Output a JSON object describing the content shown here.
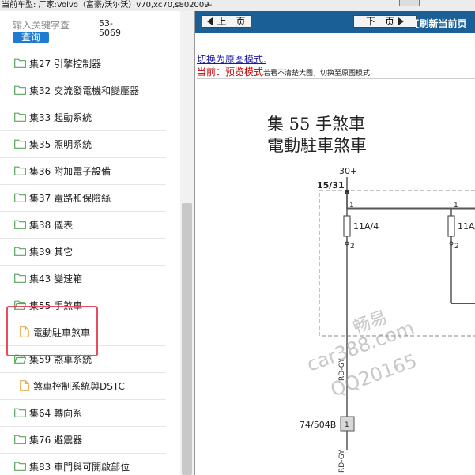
{
  "topbar": {
    "text": "当前车型:  厂家:Volvo（富豪/沃尔沃）v70,xc70,s802009-"
  },
  "sidebar": {
    "search_placeholder": "输入关键字查",
    "search_button": "查询",
    "code_top": "53-",
    "code_bottom": "5069",
    "items": [
      {
        "type": "folder",
        "label": "集27 引擎控制器",
        "expanded": false
      },
      {
        "type": "folder",
        "label": "集32 交流發電機和變壓器",
        "expanded": false
      },
      {
        "type": "folder",
        "label": "集33 起動系統",
        "expanded": false
      },
      {
        "type": "folder",
        "label": "集35 照明系統",
        "expanded": false
      },
      {
        "type": "folder",
        "label": "集36 附加電子設備",
        "expanded": false
      },
      {
        "type": "folder",
        "label": "集37 電路和保險絲",
        "expanded": false
      },
      {
        "type": "folder",
        "label": "集38 儀表",
        "expanded": false
      },
      {
        "type": "folder",
        "label": "集39 其它",
        "expanded": false
      },
      {
        "type": "folder",
        "label": "集43 變速箱",
        "expanded": false
      },
      {
        "type": "folder",
        "label": "集55 手煞車",
        "expanded": true
      },
      {
        "type": "file",
        "label": "電動駐車煞車"
      },
      {
        "type": "folder",
        "label": "集59 煞車系統",
        "expanded": true
      },
      {
        "type": "file",
        "label": "煞車控制系統與DSTC"
      },
      {
        "type": "folder",
        "label": "集64 轉向系",
        "expanded": false
      },
      {
        "type": "folder",
        "label": "集76 避震器",
        "expanded": false
      },
      {
        "type": "folder",
        "label": "集83 車門與可開啟部位",
        "expanded": false
      }
    ]
  },
  "nav": {
    "prev": "上一页",
    "next": "下一页",
    "refresh": "[刷新当前页"
  },
  "content": {
    "switch_link": "切换为原图模式.",
    "mode_prefix": "当前：",
    "mode_name": "预览模式",
    "mode_hint": "若看不清楚大图，切换至原图模式"
  },
  "diagram": {
    "title_line1": "集 55 手煞車",
    "title_line2": "電動駐車煞車",
    "supply": "30+",
    "terminal": "15/31",
    "pin_top_left": "1",
    "pin_top_right": "1",
    "fuse_left": "11A/4",
    "fuse_right": "11A/",
    "pin_bottom_left": "2",
    "pin_bottom_right": "2",
    "wire_color_upper": "RD-GY",
    "connector": "74/504B",
    "connector_pin": "1",
    "wire_color_lower": "RD-GY",
    "watermark": [
      "畅易",
      "car388.com",
      "QQ20165"
    ]
  },
  "colors": {
    "nav_bar": "#1a5f96",
    "search_button": "#1f7bd0",
    "highlight": "#e84a5f",
    "folder_icon": "#57a65a",
    "file_icon": "#e8a94a",
    "mode_text": "#c00000",
    "link_text": "#1a1aa8"
  }
}
